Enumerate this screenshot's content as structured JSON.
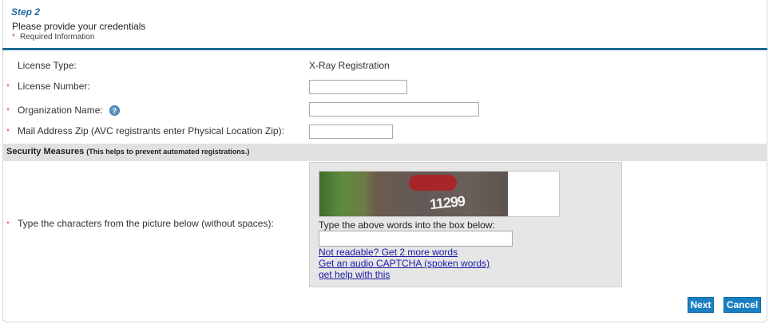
{
  "header": {
    "step_title": "Step 2",
    "subtitle": "Please provide your credentials",
    "required_marker": "*",
    "required_note": "Required Information"
  },
  "form": {
    "license_type_label": "License Type:",
    "license_type_value": "X-Ray Registration",
    "license_number_label": "License Number:",
    "license_number_value": "",
    "organization_name_label": "Organization Name:",
    "organization_name_value": "",
    "help_icon_glyph": "?",
    "zip_label": "Mail Address Zip (AVC registrants enter Physical Location Zip):",
    "zip_value": ""
  },
  "security": {
    "title": "Security Measures",
    "note": "(This helps to prevent automated registrations.)",
    "captcha_label": "Type the characters from the picture below (without spaces):",
    "captcha_image_text": "11299",
    "instruction": "Type the above words into the box below:",
    "captcha_value": "",
    "link_more_words": "Not readable? Get 2 more words",
    "link_audio": "Get an audio CAPTCHA (spoken words)",
    "link_help": "get help with this"
  },
  "buttons": {
    "next": "Next",
    "cancel": "Cancel"
  },
  "colors": {
    "accent": "#1f6aa5",
    "divider": "#1e6b95",
    "required_star": "#d0454a",
    "button_bg": "#1a7fc1",
    "link": "#1a1aa6"
  }
}
